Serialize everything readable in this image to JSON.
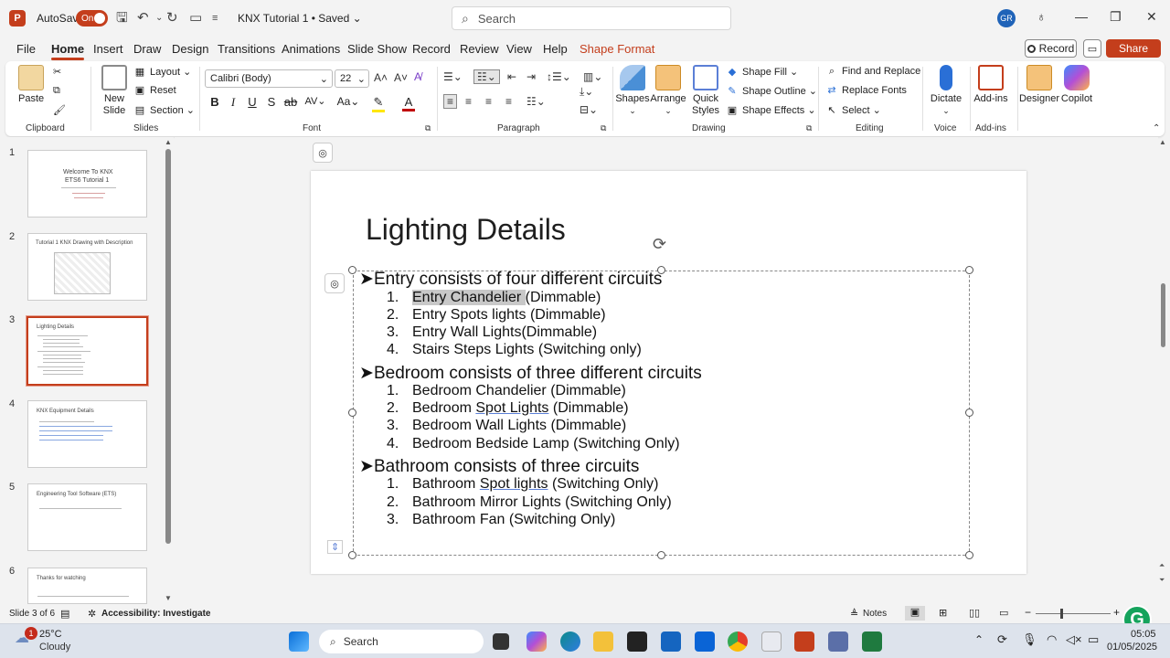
{
  "titlebar": {
    "autosave_label": "AutoSave",
    "autosave_state": "On",
    "doc_title": "KNX Tutorial 1 • Saved ⌄",
    "search_placeholder": "Search",
    "user_initials": "GR"
  },
  "menu": [
    "File",
    "Home",
    "Insert",
    "Draw",
    "Design",
    "Transitions",
    "Animations",
    "Slide Show",
    "Record",
    "Review",
    "View",
    "Help",
    "Shape Format"
  ],
  "menu_right": {
    "record": "Record",
    "share": "Share"
  },
  "ribbon": {
    "clipboard": {
      "label": "Clipboard",
      "paste": "Paste"
    },
    "slides": {
      "label": "Slides",
      "new_slide": "New Slide",
      "layout": "Layout",
      "reset": "Reset",
      "section": "Section"
    },
    "font": {
      "label": "Font",
      "family": "Calibri (Body)",
      "size": "22"
    },
    "paragraph": {
      "label": "Paragraph"
    },
    "drawing": {
      "label": "Drawing",
      "shapes": "Shapes",
      "arrange": "Arrange",
      "quick_styles": "Quick Styles",
      "shape_fill": "Shape Fill",
      "shape_outline": "Shape Outline",
      "shape_effects": "Shape Effects"
    },
    "editing": {
      "label": "Editing",
      "find_replace": "Find and Replace",
      "replace_fonts": "Replace Fonts",
      "select": "Select"
    },
    "voice": {
      "label": "Voice",
      "dictate": "Dictate"
    },
    "addins": {
      "label": "Add-ins",
      "addins": "Add-ins",
      "designer": "Designer",
      "copilot": "Copilot"
    }
  },
  "thumbnails": [
    {
      "num": "1",
      "title": "Welcome To KNX",
      "subtitle": "ETS6 Tutorial 1"
    },
    {
      "num": "2",
      "title": "Tutorial 1 KNX Drawing with Description"
    },
    {
      "num": "3",
      "title": "Lighting Details"
    },
    {
      "num": "4",
      "title": "KNX Equipment Details"
    },
    {
      "num": "5",
      "title": "Engineering Tool Software (ETS)"
    },
    {
      "num": "6",
      "title": "Thanks for watching"
    }
  ],
  "slide": {
    "title": "Lighting Details",
    "sections": [
      {
        "heading": "Entry consists of four different circuits",
        "items": [
          "Entry Chandelier (Dimmable)",
          "Entry Spots lights (Dimmable)",
          "Entry Wall Lights(Dimmable)",
          "Stairs Steps Lights (Switching only)"
        ]
      },
      {
        "heading": "Bedroom consists of three different circuits",
        "items": [
          "Bedroom Chandelier (Dimmable)",
          "Bedroom Spot Lights (Dimmable)",
          "Bedroom Wall Lights (Dimmable)",
          "Bedroom Bedside Lamp (Switching Only)"
        ]
      },
      {
        "heading": "Bathroom consists of three circuits",
        "items": [
          "Bathroom Spot lights (Switching Only)",
          "Bathroom Mirror Lights (Switching Only)",
          "Bathroom Fan (Switching Only)"
        ]
      }
    ]
  },
  "status": {
    "slide_of": "Slide 3 of 6",
    "accessibility": "Accessibility: Investigate",
    "notes": "Notes"
  },
  "taskbar": {
    "temp": "25°C",
    "weather": "Cloudy",
    "search": "Search",
    "time": "05:05",
    "date": "01/05/2025",
    "badge": "1"
  }
}
